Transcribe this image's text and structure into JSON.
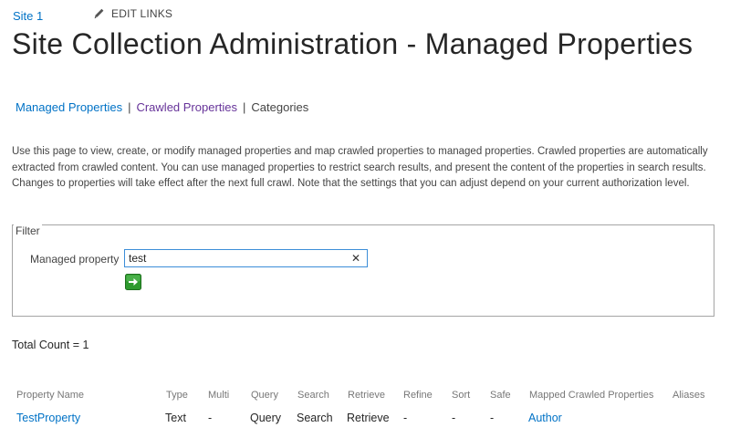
{
  "topbar": {
    "site_link": "Site 1",
    "edit_links": "EDIT LINKS"
  },
  "page": {
    "title": "Site Collection Administration - Managed Properties"
  },
  "subnav": {
    "items": [
      {
        "label": "Managed Properties"
      },
      {
        "label": "Crawled Properties"
      },
      {
        "label": "Categories"
      }
    ],
    "separator": "|"
  },
  "description": "Use this page to view, create, or modify managed properties and map crawled properties to managed properties. Crawled properties are automatically extracted from crawled content. You can use managed properties to restrict search results, and present the content of the properties in search results. Changes to properties will take effect after the next full crawl. Note that the settings that you can adjust depend on your current authorization level.",
  "filter": {
    "legend": "Filter",
    "label": "Managed property",
    "value": "test",
    "clear_glyph": "✕"
  },
  "results": {
    "total_count": "Total Count = 1",
    "columns": [
      "Property Name",
      "Type",
      "Multi",
      "Query",
      "Search",
      "Retrieve",
      "Refine",
      "Sort",
      "Safe",
      "Mapped Crawled Properties",
      "Aliases"
    ],
    "rows": [
      {
        "property_name": "TestProperty",
        "type": "Text",
        "multi": "-",
        "query": "Query",
        "search": "Search",
        "retrieve": "Retrieve",
        "refine": "-",
        "sort": "-",
        "safe": "-",
        "mapped_crawled_properties": "Author",
        "aliases": ""
      }
    ]
  },
  "colors": {
    "link": "#0072c6",
    "visited_link": "#663399",
    "go_button": "#2e9a2e"
  },
  "icons": {
    "edit": "pencil-icon",
    "go": "arrow-right-icon",
    "clear": "close-icon"
  }
}
